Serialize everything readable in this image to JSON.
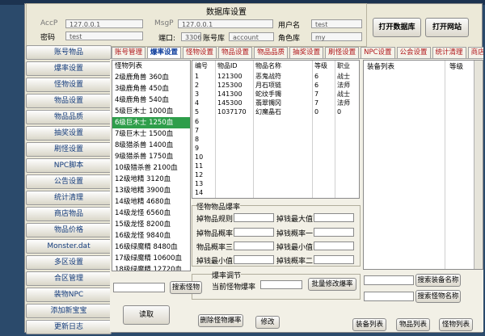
{
  "window": {
    "section_title": "数据库设置"
  },
  "db": {
    "accp_label": "AccP",
    "accp_value": "127.0.0.1",
    "msgp_label": "MsgP",
    "msgp_value": "127.0.0.1",
    "user_label": "用户名",
    "user_value": "test",
    "password_label": "密码",
    "password_value": "test",
    "port_label": "端口:",
    "port_value": "3306",
    "account_db_label": "账号库",
    "account_db_value": "account",
    "role_db_label": "角色库",
    "role_db_value": "my",
    "open_db_btn": "打开数据库",
    "open_site_btn": "打开网站"
  },
  "sidebar": [
    {
      "label": "账号物品"
    },
    {
      "label": "爆率设置"
    },
    {
      "label": "怪物设置"
    },
    {
      "label": "物品设置"
    },
    {
      "label": "物品品质"
    },
    {
      "label": "抽奖设置"
    },
    {
      "label": "刷怪设置"
    },
    {
      "label": "NPC脚本"
    },
    {
      "label": "公告设置"
    },
    {
      "label": "统计清理"
    },
    {
      "label": "商店物品"
    },
    {
      "label": "物品价格"
    },
    {
      "label": "Monster.dat"
    },
    {
      "label": "多区设置"
    },
    {
      "label": "合区管理"
    },
    {
      "label": "装物NPC"
    },
    {
      "label": "添加新宝宝"
    },
    {
      "label": "更新日志"
    }
  ],
  "tabs": [
    {
      "label": "账号管理"
    },
    {
      "label": "爆率设置"
    },
    {
      "label": "怪物设置"
    },
    {
      "label": "物品设置"
    },
    {
      "label": "物品品质"
    },
    {
      "label": "抽奖设置"
    },
    {
      "label": "刷怪设置"
    },
    {
      "label": "NPC设置"
    },
    {
      "label": "公会设置"
    },
    {
      "label": "统计清理"
    },
    {
      "label": "商店物"
    }
  ],
  "monsters": {
    "header": "怪物列表",
    "rows": [
      {
        "text": "2级鹿角兽 360血"
      },
      {
        "text": "3级鹿角兽 450血"
      },
      {
        "text": "4级鹿角兽 540血"
      },
      {
        "text": "5级巨木士 1000血"
      },
      {
        "text": "6级巨木士 1250血"
      },
      {
        "text": "7级巨木士 1500血"
      },
      {
        "text": "8级猎杀兽 1400血"
      },
      {
        "text": "9级猎杀兽 1750血"
      },
      {
        "text": "10级猎杀兽 2100血"
      },
      {
        "text": "12级地精 3120血"
      },
      {
        "text": "13级地精 3900血"
      },
      {
        "text": "14级地精 4680血"
      },
      {
        "text": "14级龙怪 6560血"
      },
      {
        "text": "15级龙怪 8200血"
      },
      {
        "text": "16级龙怪 9840血"
      },
      {
        "text": "16级绿魔精 8480血"
      },
      {
        "text": "17级绿魔精 10600血"
      },
      {
        "text": "18级绿魔精 12720血"
      }
    ]
  },
  "drops": {
    "headers": {
      "no": "编号",
      "id": "物品ID",
      "name": "物品名称",
      "level": "等级",
      "job": "职业"
    },
    "rows": [
      {
        "no": "1",
        "id": "121300",
        "name": "恶鬼战符",
        "level": "6",
        "job": "战士"
      },
      {
        "no": "2",
        "id": "125300",
        "name": "月石项链",
        "level": "6",
        "job": "法师"
      },
      {
        "no": "3",
        "id": "141300",
        "name": "蛇纹手镯",
        "level": "7",
        "job": "战士"
      },
      {
        "no": "4",
        "id": "145300",
        "name": "翡翠镯冈",
        "level": "7",
        "job": "法师"
      },
      {
        "no": "5",
        "id": "1037170",
        "name": "幻魔晶石",
        "level": "0",
        "job": "0"
      },
      {
        "no": "6"
      },
      {
        "no": "7"
      },
      {
        "no": "8"
      },
      {
        "no": "9"
      },
      {
        "no": "10"
      },
      {
        "no": "11"
      },
      {
        "no": "12"
      },
      {
        "no": "13"
      },
      {
        "no": "14"
      },
      {
        "no": "15"
      }
    ]
  },
  "equip": {
    "header_list": "装备列表",
    "header_level": "等级"
  },
  "drop_rate": {
    "group_title": "怪物物品爆率",
    "throw_rule": "掉物品规则",
    "throw_max": "掉钱最大值",
    "throw_rate": "掉物品概率",
    "throw_rate1": "掉钱概率一",
    "drop_rate3": "物品概率三",
    "throw_min": "掉钱最小值",
    "throw_min2": "掉钱最小值",
    "throw_rate2": "掉钱概率二"
  },
  "adjust": {
    "group_title": "爆率调节",
    "current_rate": "当前怪物爆率",
    "batch_btn": "批量修改爆率"
  },
  "buttons": {
    "search_monster": "搜索怪物",
    "search_equip": "搜索装备名称",
    "search_monster_name": "搜索怪物名称",
    "read": "读取",
    "delete_rate": "删除怪物爆率",
    "modify": "修改",
    "equip_list": "装备列表",
    "item_list": "物品列表",
    "monster_list": "怪物列表"
  }
}
